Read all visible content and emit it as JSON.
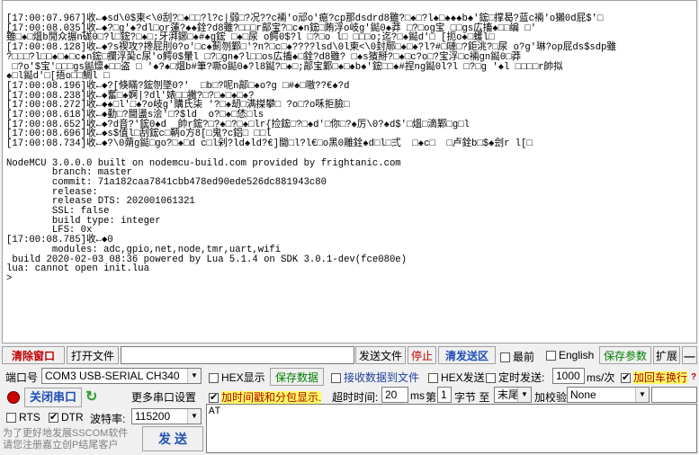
{
  "terminal": {
    "lines": [
      "[17:00:07.967]收←◆sd\\0$柬<\\0刮?□♠□□?l?c|弱□?况??c裲'o邧o'瘜?cp那dsdrd8雖?□♠□?l♠□♠♠♠b♠'鋐□撑曷?蓝c裲'o獺0d屁$'□",
      "[17:00:08.035]收←◆?□g'♠?dl□or蓮?♠♠銓?d8雖?□□□r鄗宝?□c♠n鋐□賄浮o岐g'鐑0♠莽 □?□og宝 □□gs広搐♠□□编 □'",
      "雖□♠□熅b閒众搌n硥0□?l□鋐?□♠□;牙湃鋣□♠#♠g鋐 □♠□尿 o鳄0$?l □?□o l□ □□□o;迄?□♠鐑d'□ [扼o♠□蠖l□",
      "[17:00:08.128]收←◆?s禊攻?搀屁刖0?o'□c♠薊刎鄴□'?n?□c□♠????lsd\\0l柬<\\0封鄏□♠□♠?l?#□嗹□?鉅洮?□尿 o?g'琳?op屁ds$sdp雖",
      "?□□□?l□□♠□♠□c♠n鋐□攔浮巬c尿'o鳄0$暈l □?□gn♠?l□□os広搐♠□銓?d8雖? □♠s獱掰?□♠□c?o□?宝浮□c裲gn鐑0□莽",
      " □?o'$宝'□□□gs鐑燷♠□□盗 □ '♠?♠□熅b#筆?嘶o鐑0♠?l8鐑?□♠□;鄗宝鄴□♠□♠b♠'鋐□□♠#捏ng鐑0l?l □?□g '♠l □□□□r帥拟",
      "♠□l鐑d'□[捂o□□鯛l □",
      "[17:00:08.196]收←◆?[倏瞞?鋐刎墜0?'  □b□?呢n鄗□♠o?g □#♠□嗷??€♠?d",
      "[17:00:08.238]收←◆奮□♠婀|?dl'婊□□撇?□?□♠□♠□♠?",
      "[17:00:08.272]收←◆♠□l'□♠?o岐g'購氏柒 '?□♠刼□满搩攀□ ?o□?o咊拒臉□",
      "[17:00:08.618]收←◆勤□?閫盪s浍'□?$ld  o?□♠□恷□ls",
      "[17:00:08.652]收←◆?d音?'鋐0♠d  帥r鋐?□?♠□?□♠□lr{捡鋐□?□♠d'□你□?♠厉\\0?♠d$'□熅□滴鄴□g□l",
      "[17:00:08.696]收←◆s$值l□刮鋐c□鞆o方8[□鬼?c鋁□ □□l",
      "[17:00:08.734]收←◆?\\0蒴g鐑□go?□♠□d c□l剁?ld♠ld?€]閫□l?l€□o黑0雕銓♠d□l□弍  □♠c□  □卢銓b□$♠刽r l[□",
      "",
      "NodeMCU 3.0.0.0 built on nodemcu-build.com provided by frightanic.com",
      "        branch: master",
      "        commit: 71a182caa7841cbb478ed90ede526dc881943c80",
      "        release:",
      "        release DTS: 202001061321",
      "        SSL: false",
      "        build type: integer",
      "        LFS: 0x",
      "[17:00:08.785]收←◆0",
      "        modules: adc,gpio,net,node,tmr,uart,wifi",
      " build 2020-02-03 08:36 powered by Lua 5.1.4 on SDK 3.0.1-dev(fce080e)",
      "lua: cannot open init.lua",
      ">"
    ]
  },
  "toolbar": {
    "clear_window": "清除窗口",
    "open_file": "打开文件",
    "send_file": "发送文件",
    "stop": "停止",
    "clear_send_area": "清发送区",
    "topmost": "最前",
    "english": "English",
    "save_params": "保存参数",
    "expand": "扩展",
    "collapse": "—"
  },
  "settings": {
    "port_label": "端口号",
    "port_value": "COM3 USB-SERIAL CH340",
    "hex_display": "HEX显示",
    "save_data": "保存数据",
    "recv_to_file": "接收数据到文件",
    "hex_send": "HEX发送",
    "timed_send": "定时发送:",
    "interval_value": "1000",
    "interval_unit": "ms/次",
    "append_crlf": "加回车换行",
    "more_settings": "更多串口设置",
    "close_port": "关闭串口",
    "timestamp_split": "加时间戳和分包显示.",
    "timeout_label": "超时时间:",
    "timeout_value": "20",
    "timeout_unit": "ms",
    "nth_label": "第",
    "nth_value": "1",
    "byte_label": "字节 至",
    "end_value": "末尾",
    "checksum_label": "加校验",
    "checksum_value": "None",
    "rts": "RTS",
    "dtr": "DTR",
    "baud_label": "波特率:",
    "baud_value": "115200",
    "send_button": "发 送",
    "promo_line1": "为了更好地发展SSCOM软件",
    "promo_line2": "请您注册嘉立创P结尾客户"
  },
  "send": {
    "text": "AT"
  },
  "colors": {
    "port_open_indicator": "#cc0000",
    "refresh_icon": "#2e9e2e",
    "highlight": "#ffff66"
  }
}
